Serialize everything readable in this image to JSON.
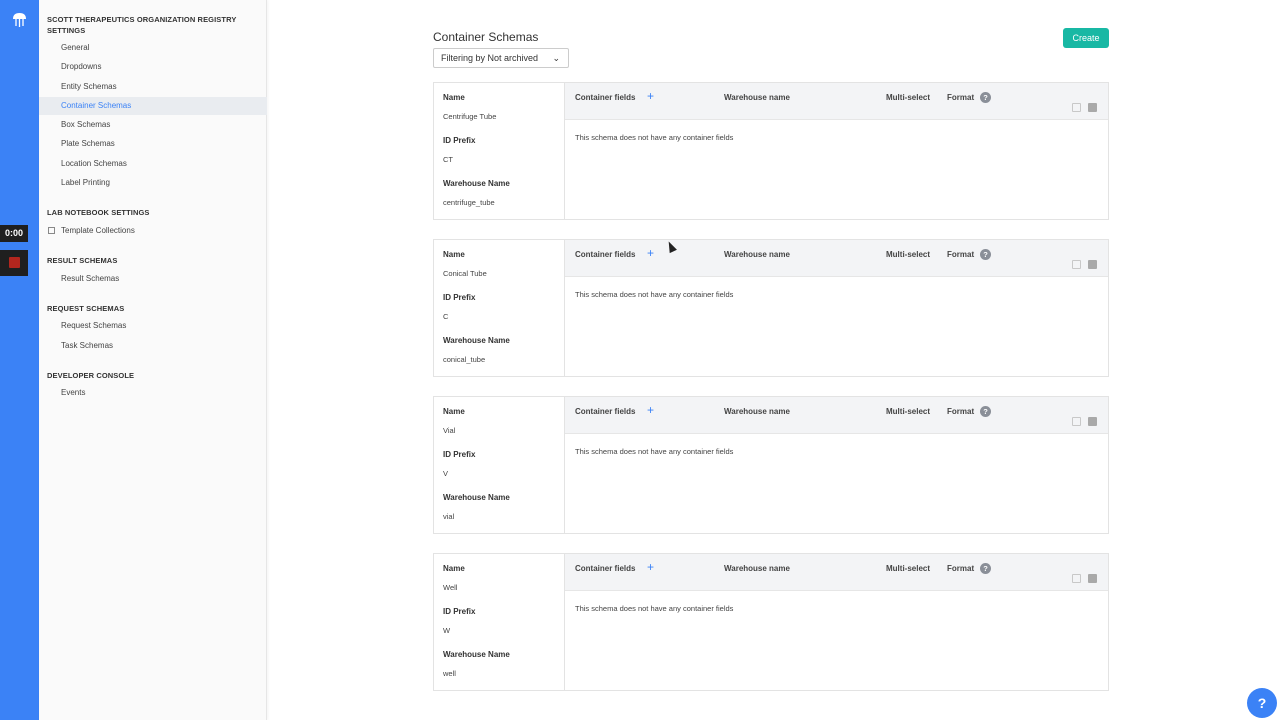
{
  "sidebar": {
    "title": "SCOTT THERAPEUTICS ORGANIZATION REGISTRY SETTINGS",
    "registry_items": [
      "General",
      "Dropdowns",
      "Entity Schemas",
      "Container Schemas",
      "Box Schemas",
      "Plate Schemas",
      "Location Schemas",
      "Label Printing"
    ],
    "lab_notebook_heading": "LAB NOTEBOOK SETTINGS",
    "lab_notebook_items": [
      "Template Collections"
    ],
    "result_heading": "RESULT SCHEMAS",
    "result_items": [
      "Result Schemas"
    ],
    "request_heading": "REQUEST SCHEMAS",
    "request_items": [
      "Request Schemas",
      "Task Schemas"
    ],
    "developer_heading": "DEVELOPER CONSOLE",
    "developer_items": [
      "Events"
    ]
  },
  "recorder": {
    "time": "0:00"
  },
  "main": {
    "title": "Container Schemas",
    "filter_label": "Filtering by Not archived",
    "create_label": "Create"
  },
  "table_labels": {
    "name": "Name",
    "id_prefix": "ID Prefix",
    "warehouse_name": "Warehouse Name",
    "container_fields": "Container fields",
    "col_warehouse": "Warehouse name",
    "col_multiselect": "Multi-select",
    "col_format": "Format",
    "empty": "This schema does not have any container fields"
  },
  "schemas": [
    {
      "name": "Centrifuge Tube",
      "id_prefix": "CT",
      "warehouse": "centrifuge_tube"
    },
    {
      "name": "Conical Tube",
      "id_prefix": "C",
      "warehouse": "conical_tube"
    },
    {
      "name": "Vial",
      "id_prefix": "V",
      "warehouse": "vial"
    },
    {
      "name": "Well",
      "id_prefix": "W",
      "warehouse": "well"
    }
  ],
  "icons": {
    "logo": "jellyfish-logo-icon",
    "add": "plus-icon",
    "help": "question-icon",
    "copy": "copy-icon",
    "archive": "archive-icon"
  },
  "colors": {
    "accent": "#3b82f6",
    "create": "#18b8a4"
  }
}
